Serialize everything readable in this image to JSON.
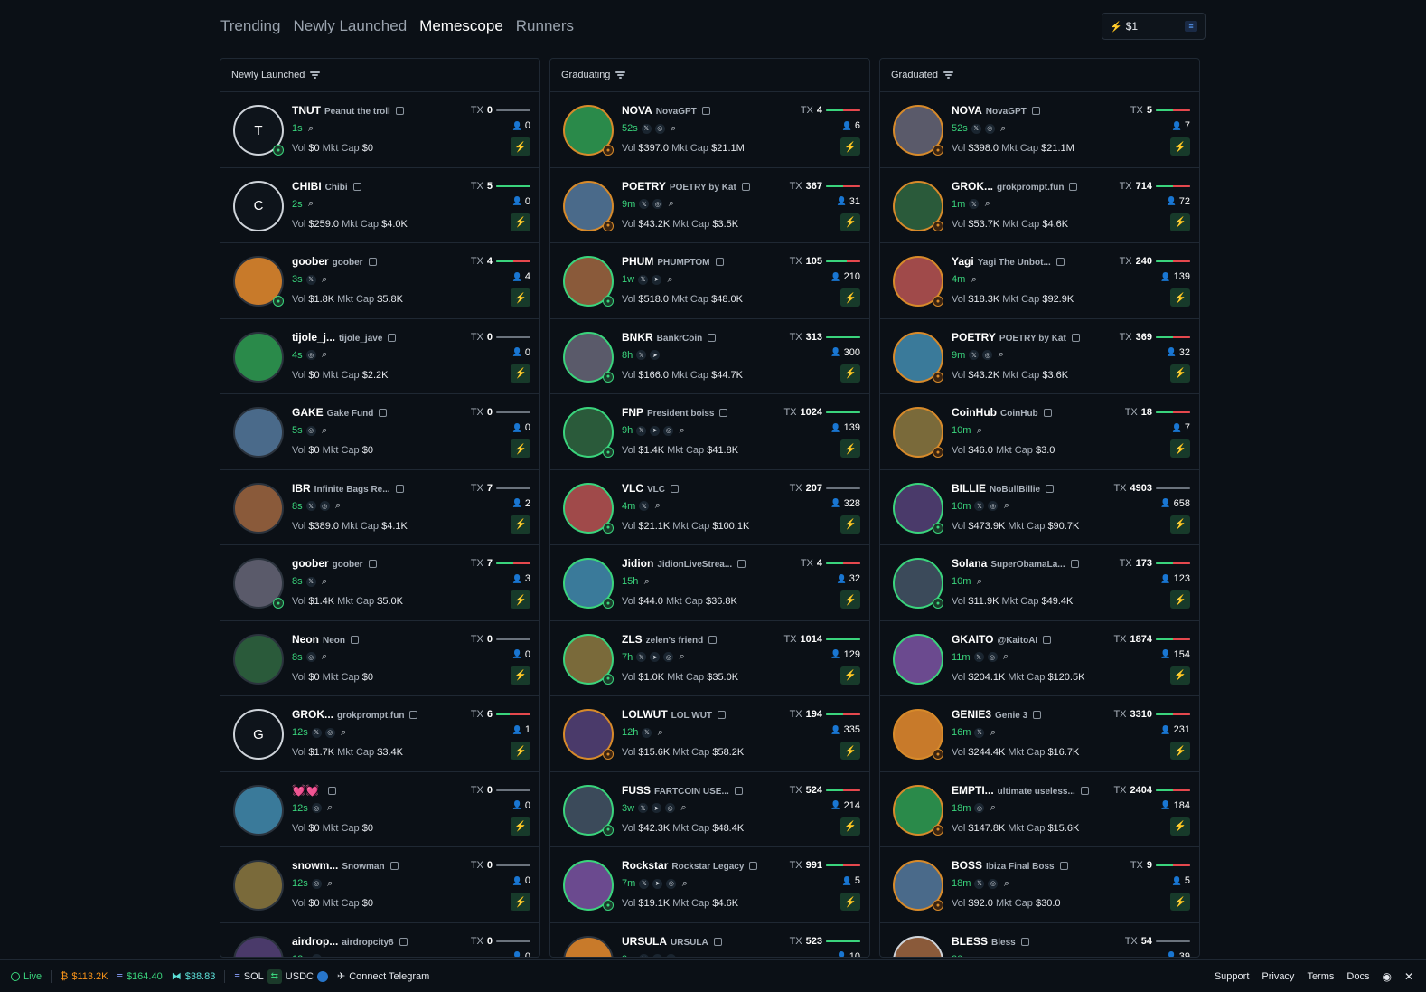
{
  "nav": {
    "tabs": [
      "Trending",
      "Newly Launched",
      "Memescope",
      "Runners"
    ],
    "active": "Memescope",
    "amount": "$1"
  },
  "columns": [
    {
      "title": "Newly Launched",
      "rows": [
        {
          "ticker": "TNUT",
          "name": "Peanut the troll",
          "age": "1s",
          "socials": [
            "search"
          ],
          "vol": "$0",
          "mcap": "$0",
          "tx": "0",
          "holders": "0",
          "green": 0,
          "red": 0,
          "avatar": "T",
          "ring": "w",
          "badge": "g"
        },
        {
          "ticker": "CHIBI",
          "name": "Chibi",
          "age": "2s",
          "socials": [
            "search"
          ],
          "vol": "$259.0",
          "mcap": "$4.0K",
          "tx": "5",
          "holders": "0",
          "green": 100,
          "red": 0,
          "avatar": "C",
          "ring": "w",
          "badge": ""
        },
        {
          "ticker": "goober",
          "name": "goober",
          "age": "3s",
          "socials": [
            "x",
            "search"
          ],
          "vol": "$1.8K",
          "mcap": "$5.8K",
          "tx": "4",
          "holders": "4",
          "green": 50,
          "red": 50,
          "avatar": "",
          "ring": "",
          "badge": "g"
        },
        {
          "ticker": "tijole_j...",
          "name": "tijole_jave",
          "age": "4s",
          "socials": [
            "web",
            "search"
          ],
          "vol": "$0",
          "mcap": "$2.2K",
          "tx": "0",
          "holders": "0",
          "green": 0,
          "red": 0,
          "avatar": "",
          "ring": "",
          "badge": ""
        },
        {
          "ticker": "GAKE",
          "name": "Gake Fund",
          "age": "5s",
          "socials": [
            "web",
            "search"
          ],
          "vol": "$0",
          "mcap": "$0",
          "tx": "0",
          "holders": "0",
          "green": 0,
          "red": 0,
          "avatar": "",
          "ring": "",
          "badge": ""
        },
        {
          "ticker": "IBR",
          "name": "Infinite Bags Re...",
          "age": "8s",
          "socials": [
            "x",
            "web",
            "search"
          ],
          "vol": "$389.0",
          "mcap": "$4.1K",
          "tx": "7",
          "holders": "2",
          "green": 0,
          "red": 0,
          "avatar": "",
          "ring": "",
          "badge": ""
        },
        {
          "ticker": "goober",
          "name": "goober",
          "age": "8s",
          "socials": [
            "x",
            "search"
          ],
          "vol": "$1.4K",
          "mcap": "$5.0K",
          "tx": "7",
          "holders": "3",
          "green": 50,
          "red": 50,
          "avatar": "",
          "ring": "",
          "badge": "g"
        },
        {
          "ticker": "Neon",
          "name": "Neon",
          "age": "8s",
          "socials": [
            "web",
            "search"
          ],
          "vol": "$0",
          "mcap": "$0",
          "tx": "0",
          "holders": "0",
          "green": 0,
          "red": 0,
          "avatar": "",
          "ring": "",
          "badge": ""
        },
        {
          "ticker": "GROK...",
          "name": "grokprompt.fun",
          "age": "12s",
          "socials": [
            "x",
            "web",
            "search"
          ],
          "vol": "$1.7K",
          "mcap": "$3.4K",
          "tx": "6",
          "holders": "1",
          "green": 40,
          "red": 60,
          "avatar": "G",
          "ring": "w",
          "badge": ""
        },
        {
          "ticker": "💓💓",
          "name": "",
          "age": "12s",
          "socials": [
            "web",
            "search"
          ],
          "vol": "$0",
          "mcap": "$0",
          "tx": "0",
          "holders": "0",
          "green": 0,
          "red": 0,
          "avatar": "",
          "ring": "",
          "badge": ""
        },
        {
          "ticker": "snowm...",
          "name": "Snowman",
          "age": "12s",
          "socials": [
            "web",
            "search"
          ],
          "vol": "$0",
          "mcap": "$0",
          "tx": "0",
          "holders": "0",
          "green": 0,
          "red": 0,
          "avatar": "",
          "ring": "",
          "badge": ""
        },
        {
          "ticker": "airdrop...",
          "name": "airdropcity8",
          "age": "12s",
          "socials": [
            "web"
          ],
          "vol": "",
          "mcap": "",
          "tx": "0",
          "holders": "0",
          "green": 0,
          "red": 0,
          "avatar": "",
          "ring": "",
          "badge": ""
        }
      ]
    },
    {
      "title": "Graduating",
      "rows": [
        {
          "ticker": "NOVA",
          "name": "NovaGPT",
          "age": "52s",
          "socials": [
            "x",
            "web",
            "search"
          ],
          "vol": "$397.0",
          "mcap": "$21.1M",
          "tx": "4",
          "holders": "6",
          "green": 50,
          "red": 50,
          "avatar": "",
          "ring": "o",
          "badge": "o"
        },
        {
          "ticker": "POETRY",
          "name": "POETRY by Kat",
          "age": "9m",
          "socials": [
            "x",
            "web",
            "search"
          ],
          "vol": "$43.2K",
          "mcap": "$3.5K",
          "tx": "367",
          "holders": "31",
          "green": 50,
          "red": 50,
          "avatar": "",
          "ring": "o",
          "badge": "o"
        },
        {
          "ticker": "PHUM",
          "name": "PHUMPTOM",
          "age": "1w",
          "socials": [
            "x",
            "tg",
            "search"
          ],
          "vol": "$518.0",
          "mcap": "$48.0K",
          "tx": "105",
          "holders": "210",
          "green": 60,
          "red": 40,
          "avatar": "",
          "ring": "g",
          "badge": "g"
        },
        {
          "ticker": "BNKR",
          "name": "BankrCoin",
          "age": "8h",
          "socials": [
            "x",
            "tg"
          ],
          "vol": "$166.0",
          "mcap": "$44.7K",
          "tx": "313",
          "holders": "300",
          "green": 100,
          "red": 0,
          "avatar": "",
          "ring": "g",
          "badge": "g"
        },
        {
          "ticker": "FNP",
          "name": "President boiss",
          "age": "9h",
          "socials": [
            "x",
            "tg",
            "web",
            "search"
          ],
          "vol": "$1.4K",
          "mcap": "$41.8K",
          "tx": "1024",
          "holders": "139",
          "green": 100,
          "red": 0,
          "avatar": "",
          "ring": "g",
          "badge": "g"
        },
        {
          "ticker": "VLC",
          "name": "VLC",
          "age": "4m",
          "socials": [
            "x",
            "search"
          ],
          "vol": "$21.1K",
          "mcap": "$100.1K",
          "tx": "207",
          "holders": "328",
          "green": 0,
          "red": 0,
          "avatar": "",
          "ring": "g",
          "badge": "g"
        },
        {
          "ticker": "Jidion",
          "name": "JidionLiveStrea...",
          "age": "15h",
          "socials": [
            "search"
          ],
          "vol": "$44.0",
          "mcap": "$36.8K",
          "tx": "4",
          "holders": "32",
          "green": 50,
          "red": 50,
          "avatar": "",
          "ring": "g",
          "badge": "g"
        },
        {
          "ticker": "ZLS",
          "name": "zelen's friend",
          "age": "7h",
          "socials": [
            "x",
            "tg",
            "web",
            "search"
          ],
          "vol": "$1.0K",
          "mcap": "$35.0K",
          "tx": "1014",
          "holders": "129",
          "green": 100,
          "red": 0,
          "avatar": "",
          "ring": "g",
          "badge": "g"
        },
        {
          "ticker": "LOLWUT",
          "name": "LOL WUT",
          "age": "12h",
          "socials": [
            "x",
            "search"
          ],
          "vol": "$15.6K",
          "mcap": "$58.2K",
          "tx": "194",
          "holders": "335",
          "green": 50,
          "red": 50,
          "avatar": "",
          "ring": "o",
          "badge": "o"
        },
        {
          "ticker": "FUSS",
          "name": "FARTCOIN USE...",
          "age": "3w",
          "socials": [
            "x",
            "tg",
            "web",
            "search"
          ],
          "vol": "$42.3K",
          "mcap": "$48.4K",
          "tx": "524",
          "holders": "214",
          "green": 50,
          "red": 50,
          "avatar": "",
          "ring": "g",
          "badge": "g"
        },
        {
          "ticker": "Rockstar",
          "name": "Rockstar Legacy",
          "age": "7m",
          "socials": [
            "x",
            "tg",
            "web",
            "search"
          ],
          "vol": "$19.1K",
          "mcap": "$4.6K",
          "tx": "991",
          "holders": "5",
          "green": 50,
          "red": 50,
          "avatar": "",
          "ring": "g",
          "badge": "g"
        },
        {
          "ticker": "URSULA",
          "name": "URSULA",
          "age": "3m",
          "socials": [
            "x",
            "tg",
            "web"
          ],
          "vol": "",
          "mcap": "",
          "tx": "523",
          "holders": "10",
          "green": 100,
          "red": 0,
          "avatar": "",
          "ring": "",
          "badge": ""
        }
      ]
    },
    {
      "title": "Graduated",
      "rows": [
        {
          "ticker": "NOVA",
          "name": "NovaGPT",
          "age": "52s",
          "socials": [
            "x",
            "web",
            "search"
          ],
          "vol": "$398.0",
          "mcap": "$21.1M",
          "tx": "5",
          "holders": "7",
          "green": 50,
          "red": 50,
          "avatar": "",
          "ring": "o",
          "badge": "o"
        },
        {
          "ticker": "GROK...",
          "name": "grokprompt.fun",
          "age": "1m",
          "socials": [
            "x",
            "search"
          ],
          "vol": "$53.7K",
          "mcap": "$4.6K",
          "tx": "714",
          "holders": "72",
          "green": 50,
          "red": 50,
          "avatar": "",
          "ring": "o",
          "badge": "o"
        },
        {
          "ticker": "Yagi",
          "name": "Yagi The Unbot...",
          "age": "4m",
          "socials": [
            "search"
          ],
          "vol": "$18.3K",
          "mcap": "$92.9K",
          "tx": "240",
          "holders": "139",
          "green": 50,
          "red": 50,
          "avatar": "",
          "ring": "o",
          "badge": "o"
        },
        {
          "ticker": "POETRY",
          "name": "POETRY by Kat",
          "age": "9m",
          "socials": [
            "x",
            "web",
            "search"
          ],
          "vol": "$43.2K",
          "mcap": "$3.6K",
          "tx": "369",
          "holders": "32",
          "green": 50,
          "red": 50,
          "avatar": "",
          "ring": "o",
          "badge": "o"
        },
        {
          "ticker": "CoinHub",
          "name": "CoinHub",
          "age": "10m",
          "socials": [
            "search"
          ],
          "vol": "$46.0",
          "mcap": "$3.0",
          "tx": "18",
          "holders": "7",
          "green": 50,
          "red": 50,
          "avatar": "",
          "ring": "o",
          "badge": "o"
        },
        {
          "ticker": "BILLIE",
          "name": "NoBullBillie",
          "age": "10m",
          "socials": [
            "x",
            "web",
            "search"
          ],
          "vol": "$473.9K",
          "mcap": "$90.7K",
          "tx": "4903",
          "holders": "658",
          "green": 0,
          "red": 0,
          "avatar": "",
          "ring": "g",
          "badge": "g"
        },
        {
          "ticker": "Solana",
          "name": "SuperObamaLa...",
          "age": "10m",
          "socials": [
            "search"
          ],
          "vol": "$11.9K",
          "mcap": "$49.4K",
          "tx": "173",
          "holders": "123",
          "green": 50,
          "red": 50,
          "avatar": "",
          "ring": "g",
          "badge": "g"
        },
        {
          "ticker": "GKAITO",
          "name": "@KaitoAI",
          "age": "11m",
          "socials": [
            "x",
            "web",
            "search"
          ],
          "vol": "$204.1K",
          "mcap": "$120.5K",
          "tx": "1874",
          "holders": "154",
          "green": 50,
          "red": 50,
          "avatar": "",
          "ring": "g",
          "badge": ""
        },
        {
          "ticker": "GENIE3",
          "name": "Genie 3",
          "age": "16m",
          "socials": [
            "x",
            "search"
          ],
          "vol": "$244.4K",
          "mcap": "$16.7K",
          "tx": "3310",
          "holders": "231",
          "green": 50,
          "red": 50,
          "avatar": "",
          "ring": "o",
          "badge": "o"
        },
        {
          "ticker": "EMPTI...",
          "name": "ultimate useless...",
          "age": "18m",
          "socials": [
            "web",
            "search"
          ],
          "vol": "$147.8K",
          "mcap": "$15.6K",
          "tx": "2404",
          "holders": "184",
          "green": 50,
          "red": 50,
          "avatar": "",
          "ring": "o",
          "badge": "o"
        },
        {
          "ticker": "BOSS",
          "name": "Ibiza Final Boss",
          "age": "18m",
          "socials": [
            "x",
            "web",
            "search"
          ],
          "vol": "$92.0",
          "mcap": "$30.0",
          "tx": "9",
          "holders": "5",
          "green": 50,
          "red": 50,
          "avatar": "",
          "ring": "o",
          "badge": "o"
        },
        {
          "ticker": "BLESS",
          "name": "Bless",
          "age": "20m",
          "socials": [],
          "vol": "",
          "mcap": "",
          "tx": "54",
          "holders": "39",
          "green": 0,
          "red": 0,
          "avatar": "",
          "ring": "w",
          "badge": ""
        }
      ]
    }
  ],
  "labels": {
    "tx": "TX",
    "vol": "Vol",
    "mcap": "Mkt Cap"
  },
  "footer": {
    "live": "Live",
    "btc": "$113.2K",
    "eth": "$164.40",
    "sol_price": "$38.83",
    "sol": "SOL",
    "usdc": "USDC",
    "telegram": "Connect Telegram",
    "links": [
      "Support",
      "Privacy",
      "Terms",
      "Docs"
    ]
  },
  "colors": {
    "green": "#3ad47c",
    "red": "#e5484d",
    "orange": "#d78a2a",
    "bg": "#0b1016"
  }
}
